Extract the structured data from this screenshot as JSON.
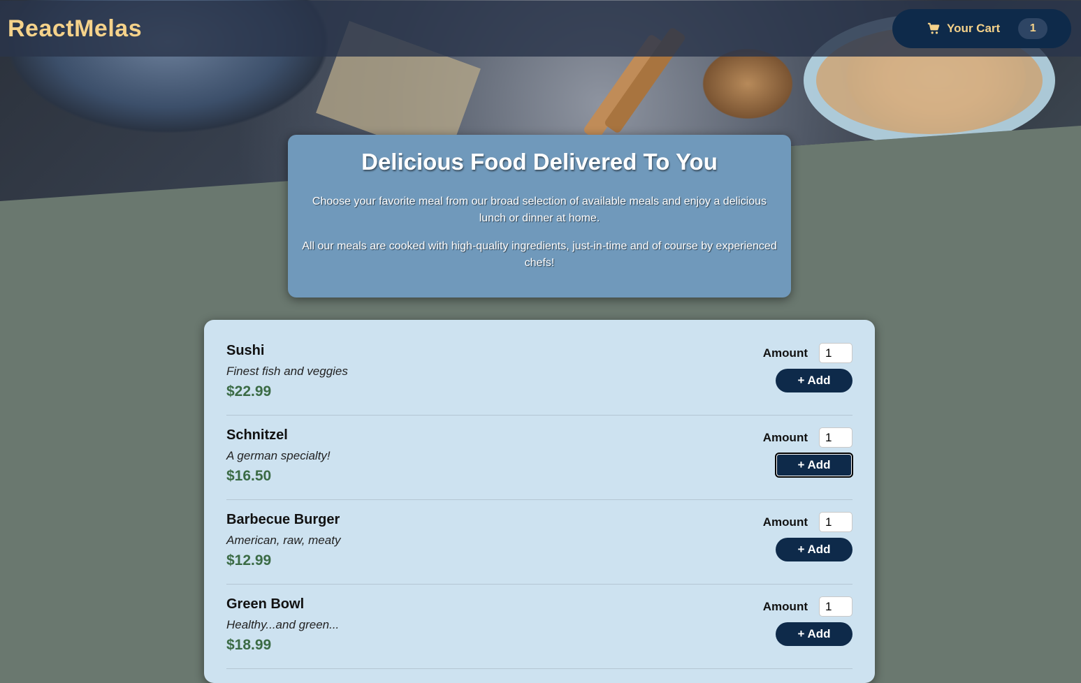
{
  "header": {
    "logo": "ReactMelas",
    "cart": {
      "label": "Your Cart",
      "count": "1",
      "icon": "cart-icon"
    }
  },
  "summary": {
    "title": "Delicious Food Delivered To You",
    "paragraph1": "Choose your favorite meal from our broad selection of available meals and enjoy a delicious lunch or dinner at home.",
    "paragraph2": "All our meals are cooked with high-quality ingredients, just-in-time and of course by experienced chefs!"
  },
  "meals": [
    {
      "name": "Sushi",
      "description": "Finest fish and veggies",
      "price": "$22.99",
      "amount_label": "Amount",
      "amount": "1",
      "add_label": "+ Add"
    },
    {
      "name": "Schnitzel",
      "description": "A german specialty!",
      "price": "$16.50",
      "amount_label": "Amount",
      "amount": "1",
      "add_label": "+ Add"
    },
    {
      "name": "Barbecue Burger",
      "description": "American, raw, meaty",
      "price": "$12.99",
      "amount_label": "Amount",
      "amount": "1",
      "add_label": "+ Add"
    },
    {
      "name": "Green Bowl",
      "description": "Healthy...and green...",
      "price": "$18.99",
      "amount_label": "Amount",
      "amount": "1",
      "add_label": "+ Add"
    }
  ],
  "colors": {
    "accent": "#f5d28a",
    "dark_blue": "#0e2a4a",
    "price_green": "#3b6b45",
    "page_bg": "#6a786f"
  }
}
